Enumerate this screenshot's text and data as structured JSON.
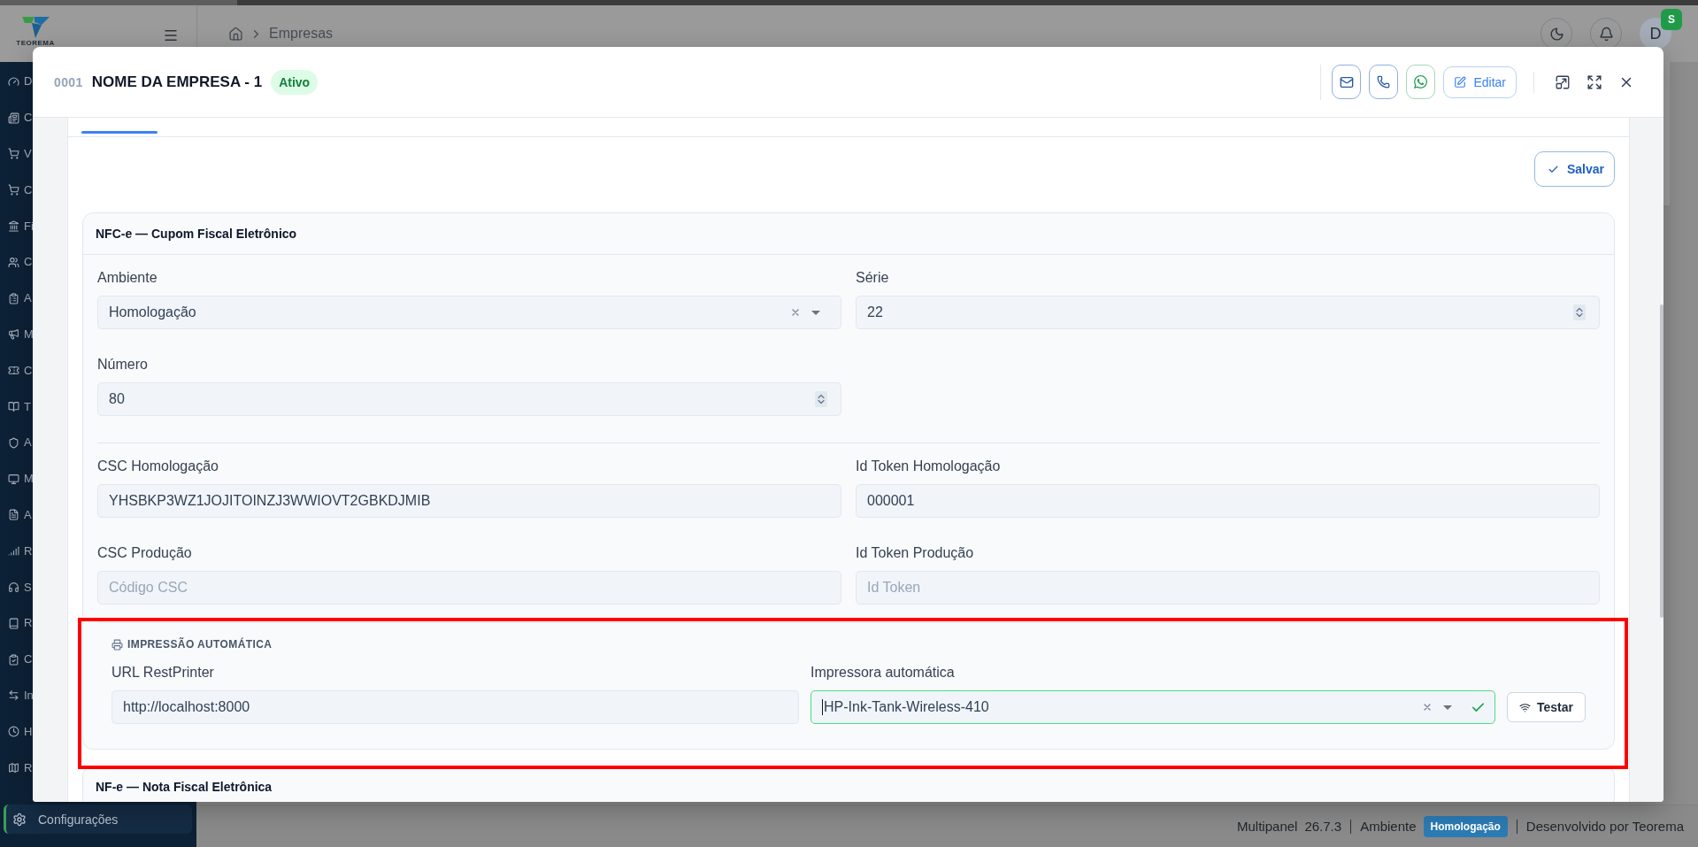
{
  "logo": {
    "text": "TEOREMA"
  },
  "sidebar": {
    "items": [
      {
        "label": "D",
        "selected": false
      },
      {
        "label": "C",
        "selected": false
      },
      {
        "label": "V",
        "selected": false
      },
      {
        "label": "C",
        "selected": false
      },
      {
        "label": "Fi",
        "selected": false
      },
      {
        "label": "C",
        "selected": false
      },
      {
        "label": "A",
        "selected": false
      },
      {
        "label": "M",
        "selected": false
      },
      {
        "label": "C",
        "selected": false
      },
      {
        "label": "T",
        "selected": false
      },
      {
        "label": "A",
        "selected": false
      },
      {
        "label": "M",
        "selected": false
      },
      {
        "label": "A",
        "selected": false
      },
      {
        "label": "R",
        "selected": false
      },
      {
        "label": "S",
        "selected": false
      },
      {
        "label": "R",
        "selected": false
      },
      {
        "label": "C",
        "selected": false
      },
      {
        "label": "In",
        "selected": false
      },
      {
        "label": "H",
        "selected": false
      },
      {
        "label": "R",
        "selected": false
      }
    ],
    "bottom_item": {
      "label": "Configurações",
      "selected": true
    }
  },
  "header": {
    "breadcrumb": [
      "Empresas"
    ],
    "avatar": {
      "initial": "D",
      "badge": "S"
    }
  },
  "modal": {
    "code": "0001",
    "title": "NOME DA EMPRESA - 1",
    "status": "Ativo",
    "actions": [
      {
        "kind": "email"
      },
      {
        "kind": "phone"
      },
      {
        "kind": "whatsapp"
      },
      {
        "kind": "edit",
        "label": "Editar"
      }
    ],
    "tabs": [
      {
        "selected": true
      }
    ],
    "save_button": "Salvar",
    "sections": [
      {
        "title": "NFC-e — Cupom Fiscal Eletrônico",
        "groups": [
          {
            "fields": [
              {
                "label": "Ambiente",
                "kind": "select",
                "value": "Homologação"
              },
              {
                "label": "Série",
                "kind": "number",
                "value": "22"
              },
              {
                "label": "Número",
                "kind": "number",
                "value": "80"
              }
            ]
          },
          {
            "fields": [
              {
                "label": "CSC Homologação",
                "kind": "text",
                "value": "YHSBKP3WZ1JOJITOINZJ3WWIOVT2GBKDJMIB"
              },
              {
                "label": "Id Token Homologação",
                "kind": "text",
                "value": "000001"
              },
              {
                "label": "CSC Produção",
                "kind": "text",
                "placeholder": "Código CSC"
              },
              {
                "label": "Id Token Produção",
                "kind": "text",
                "placeholder": "Id Token"
              }
            ]
          }
        ],
        "printing": {
          "title": "IMPRESSÃO AUTOMÁTICA",
          "highlighted": true,
          "url_field": {
            "label": "URL RestPrinter",
            "value": "http://localhost:8000"
          },
          "printer_field": {
            "label": "Impressora automática",
            "value": "HP-Ink-Tank-Wireless-410",
            "focused": true,
            "valid": true
          },
          "test_button": "Testar"
        }
      },
      {
        "title": "NF-e — Nota Fiscal Eletrônica"
      }
    ]
  },
  "status_bar": {
    "app": "Multipanel",
    "version": "26.7.3",
    "environment_label": "Ambiente",
    "environment": "Homologação",
    "credit": "Desenvolvido por Teorema"
  }
}
